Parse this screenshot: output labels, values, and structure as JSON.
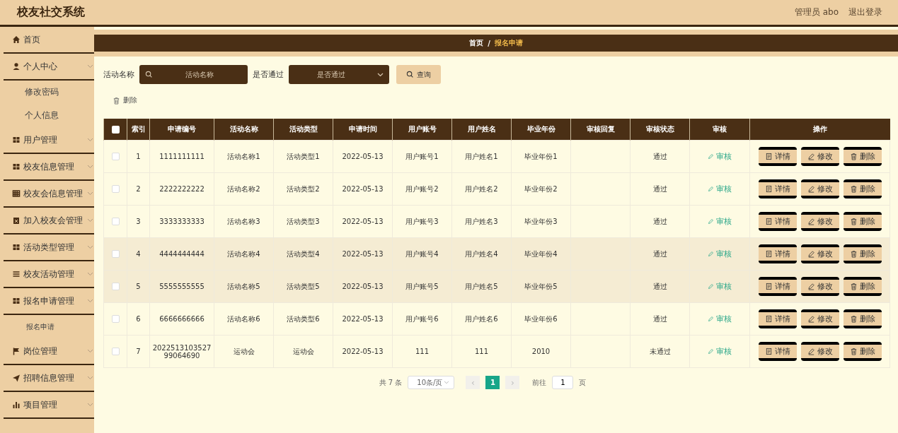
{
  "header": {
    "title": "校友社交系统",
    "user": "管理员 abo",
    "logout": "退出登录"
  },
  "sidebar": {
    "items": [
      {
        "label": "首页",
        "submenu": false
      },
      {
        "label": "个人中心",
        "submenu": true,
        "children": [
          {
            "label": "修改密码"
          },
          {
            "label": "个人信息"
          }
        ]
      },
      {
        "label": "用户管理",
        "submenu": true
      },
      {
        "label": "校友信息管理",
        "submenu": true
      },
      {
        "label": "校友会信息管理",
        "submenu": true
      },
      {
        "label": "加入校友会管理",
        "submenu": true
      },
      {
        "label": "活动类型管理",
        "submenu": true
      },
      {
        "label": "校友活动管理",
        "submenu": true
      },
      {
        "label": "报名申请管理",
        "submenu": true,
        "children": [
          {
            "label": "报名申请"
          }
        ]
      },
      {
        "label": "岗位管理",
        "submenu": true
      },
      {
        "label": "招聘信息管理",
        "submenu": true
      },
      {
        "label": "项目管理",
        "submenu": true
      }
    ]
  },
  "breadcrumb": {
    "home": "首页",
    "separator": "/",
    "current": "报名申请"
  },
  "filters": {
    "name_label": "活动名称",
    "name_placeholder": "活动名称",
    "pass_label": "是否通过",
    "pass_placeholder": "是否通过",
    "search_button": "查询"
  },
  "delete_button": "删除",
  "table": {
    "select_all_checked": false,
    "columns": [
      "索引",
      "申请编号",
      "活动名称",
      "活动类型",
      "申请时间",
      "用户账号",
      "用户姓名",
      "毕业年份",
      "审核回复",
      "审核状态",
      "审核",
      "操作"
    ],
    "rows": [
      {
        "checked": false,
        "highlighted": false,
        "cells": [
          "1",
          "1111111111",
          "活动名称1",
          "活动类型1",
          "2022-05-13",
          "用户账号1",
          "用户姓名1",
          "毕业年份1",
          "",
          "通过"
        ],
        "review": "审核",
        "actions": [
          "详情",
          "修改",
          "删除"
        ]
      },
      {
        "checked": false,
        "highlighted": false,
        "cells": [
          "2",
          "2222222222",
          "活动名称2",
          "活动类型2",
          "2022-05-13",
          "用户账号2",
          "用户姓名2",
          "毕业年份2",
          "",
          "通过"
        ],
        "review": "审核",
        "actions": [
          "详情",
          "修改",
          "删除"
        ]
      },
      {
        "checked": false,
        "highlighted": false,
        "cells": [
          "3",
          "3333333333",
          "活动名称3",
          "活动类型3",
          "2022-05-13",
          "用户账号3",
          "用户姓名3",
          "毕业年份3",
          "",
          "通过"
        ],
        "review": "审核",
        "actions": [
          "详情",
          "修改",
          "删除"
        ]
      },
      {
        "checked": false,
        "highlighted": true,
        "cells": [
          "4",
          "4444444444",
          "活动名称4",
          "活动类型4",
          "2022-05-13",
          "用户账号4",
          "用户姓名4",
          "毕业年份4",
          "",
          "通过"
        ],
        "review": "审核",
        "actions": [
          "详情",
          "修改",
          "删除"
        ]
      },
      {
        "checked": false,
        "highlighted": true,
        "cells": [
          "5",
          "5555555555",
          "活动名称5",
          "活动类型5",
          "2022-05-13",
          "用户账号5",
          "用户姓名5",
          "毕业年份5",
          "",
          "通过"
        ],
        "review": "审核",
        "actions": [
          "详情",
          "修改",
          "删除"
        ]
      },
      {
        "checked": false,
        "highlighted": false,
        "cells": [
          "6",
          "6666666666",
          "活动名称6",
          "活动类型6",
          "2022-05-13",
          "用户账号6",
          "用户姓名6",
          "毕业年份6",
          "",
          "通过"
        ],
        "review": "审核",
        "actions": [
          "详情",
          "修改",
          "删除"
        ]
      },
      {
        "checked": false,
        "highlighted": false,
        "cells": [
          "7",
          "202251310352799064690",
          "运动会",
          "运动会",
          "2022-05-13",
          "111",
          "111",
          "2010",
          "",
          "未通过"
        ],
        "review": "审核",
        "actions": [
          "详情",
          "修改",
          "删除"
        ]
      }
    ]
  },
  "pagination": {
    "total": "共 7 条",
    "page_size": "10条/页",
    "prev": "‹",
    "pages": [
      {
        "label": "1",
        "selected": true
      }
    ],
    "next": "›",
    "goto_label": "前往",
    "goto_value": "1",
    "goto_suffix": "页"
  }
}
